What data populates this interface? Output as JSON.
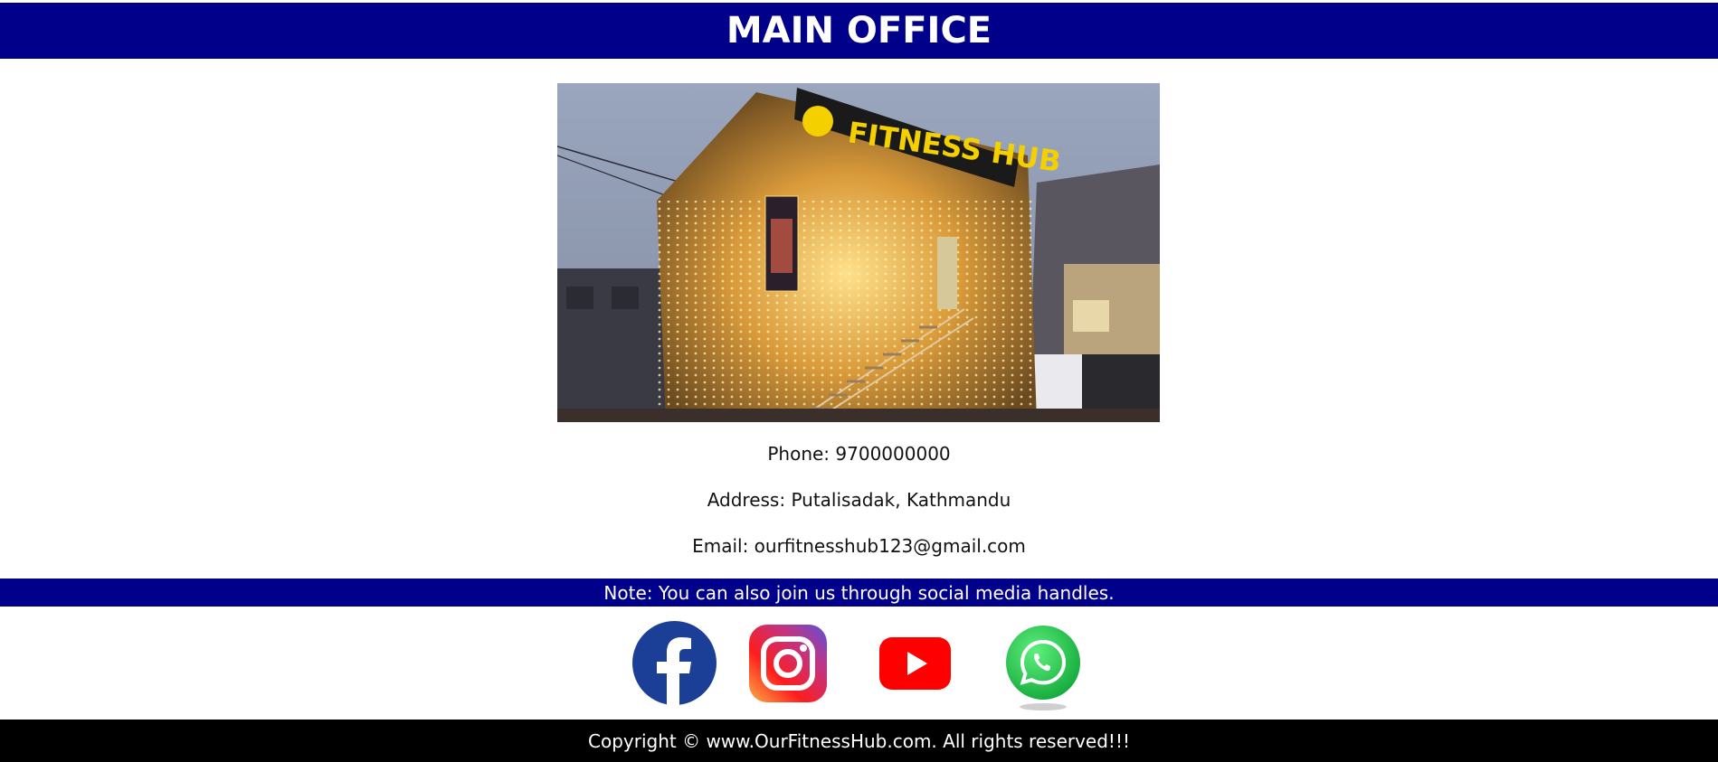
{
  "header": {
    "title": "MAIN OFFICE"
  },
  "photo": {
    "sign_text": "FITNESS HUB",
    "banner_text": "FITNESS HUB"
  },
  "contact": {
    "phone": "Phone: 9700000000",
    "address": "Address: Putalisadak, Kathmandu",
    "email": "Email: ourfitnesshub123@gmail.com"
  },
  "note": {
    "text": "Note: You can also join us through social media handles."
  },
  "social": {
    "items": [
      {
        "icon": "facebook-icon",
        "color": "#1b3f97"
      },
      {
        "icon": "instagram-icon",
        "color": "#c13584"
      },
      {
        "icon": "youtube-icon",
        "color": "#ff0000"
      },
      {
        "icon": "whatsapp-icon",
        "color": "#25d366"
      }
    ]
  },
  "footer": {
    "copyright": "Copyright © www.OurFitnessHub.com. All rights reserved!!!"
  },
  "colors": {
    "bar": "#00008b",
    "footer": "#000000",
    "text": "#111111"
  }
}
